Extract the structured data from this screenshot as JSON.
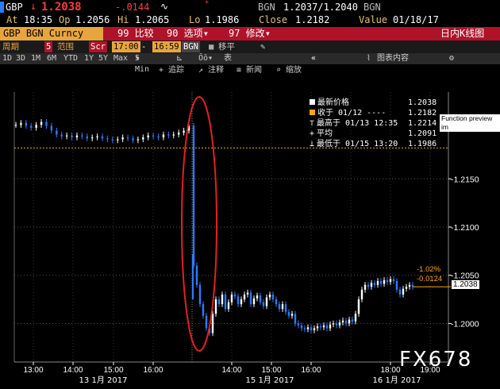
{
  "quote": {
    "ticker": "GBP",
    "arrow": "↓",
    "last": "1.2038",
    "change": "-.0144",
    "source": "BGN",
    "bid_ask": "1.2037/1.2040",
    "source2": "BGN",
    "at_label": "At",
    "at_time": "18:35",
    "op_label": "Op",
    "op": "1.2056",
    "hi_label": "Hi",
    "hi": "1.2065",
    "lo_label": "Lo",
    "lo": "1.1986",
    "close_label": "Close",
    "close": "1.2182",
    "value_label": "Value",
    "value_date": "01/18/17"
  },
  "toolbar": {
    "security": "GBP BGN Curncy",
    "compare": "99 比较",
    "options": "90 选项",
    "edit": "97 修改",
    "title": "日内K线图"
  },
  "controls": {
    "period_label": "周期",
    "period_value": "5",
    "range_label": "范围",
    "scr": "Scr",
    "from": "17:00",
    "dash": "-",
    "to": "16:59",
    "source": "BGN",
    "shift": "移平",
    "interval": "5 Min"
  },
  "ranges": [
    "1D",
    "3D",
    "1M",
    "6M",
    "YTD",
    "1Y",
    "5Y",
    "Max"
  ],
  "ranges_extra": {
    "table": "表",
    "chart_content": "图表内容"
  },
  "annotate": {
    "track": "追踪",
    "note": "注释",
    "news": "新闻",
    "zoom": "缩放"
  },
  "legend": [
    {
      "label": "最新价格",
      "value": "1.2038",
      "color": "#ffffff"
    },
    {
      "label": "收于 01/12 ----",
      "value": "1.2182",
      "color": "#ffa500"
    },
    {
      "label": "最高于 01/13 12:35",
      "value": "1.2214",
      "color": "#ffffff"
    },
    {
      "label": "平均",
      "value": "1.2091",
      "color": "#ffffff"
    },
    {
      "label": "最低于 01/15 13:20",
      "value": "1.1986",
      "color": "#ffffff"
    }
  ],
  "tooltip": "Function preview im",
  "price_tags": {
    "pct": "-1.02%",
    "chg": "-0.0124",
    "last": "1.2038"
  },
  "watermark": "FX678",
  "chart_data": {
    "type": "candlestick",
    "title": "",
    "ylim": [
      1.196,
      1.224
    ],
    "y_ticks": [
      "1.2150",
      "1.2100",
      "1.2050",
      "1.2000"
    ],
    "reference_line": {
      "label": "收于 01/12",
      "value": 1.2182
    },
    "x_ticks": [
      "13:00",
      "14:00",
      "15:00",
      "16:00",
      "14:00",
      "15:00",
      "16:00",
      "18:00",
      "19:00"
    ],
    "x_dates": [
      "13 1月 2017",
      "15 1月 2017",
      "16 1月 2017"
    ],
    "series_close": [
      1.2206,
      1.2208,
      1.2205,
      1.2203,
      1.2206,
      1.2209,
      1.2205,
      1.22,
      1.2196,
      1.2194,
      1.2195,
      1.2193,
      1.2195,
      1.2194,
      1.2192,
      1.2193,
      1.2194,
      1.2192,
      1.2191,
      1.219,
      1.2191,
      1.2193,
      1.2192,
      1.219,
      1.2191,
      1.2193,
      1.2195,
      1.2194,
      1.2193,
      1.2196,
      1.2195,
      1.2196,
      1.2198,
      1.22,
      1.2205,
      1.206,
      1.204,
      1.202,
      1.2008,
      1.1995,
      1.199,
      1.201,
      1.2025,
      1.202,
      1.203,
      1.2015,
      1.2022,
      1.203,
      1.2028,
      1.202,
      1.2025,
      1.203,
      1.2032,
      1.202,
      1.2026,
      1.2029,
      1.2022,
      1.2018,
      1.2027,
      1.203,
      1.2025,
      1.202,
      1.2015,
      1.202,
      1.2012,
      1.2008,
      1.201,
      1.2,
      1.1998,
      1.1995,
      1.1994,
      1.1996,
      1.1993,
      1.1995,
      1.1997,
      1.1996,
      1.1998,
      1.1995,
      1.1999,
      1.2,
      1.1998,
      1.2001,
      1.2003,
      1.2,
      1.2004,
      1.2002,
      1.201,
      1.2025,
      1.2035,
      1.204,
      1.2038,
      1.2042,
      1.204,
      1.2044,
      1.2041,
      1.2045,
      1.2043,
      1.2046,
      1.2044,
      1.2035,
      1.203,
      1.2036,
      1.2038,
      1.204,
      1.2038
    ]
  }
}
